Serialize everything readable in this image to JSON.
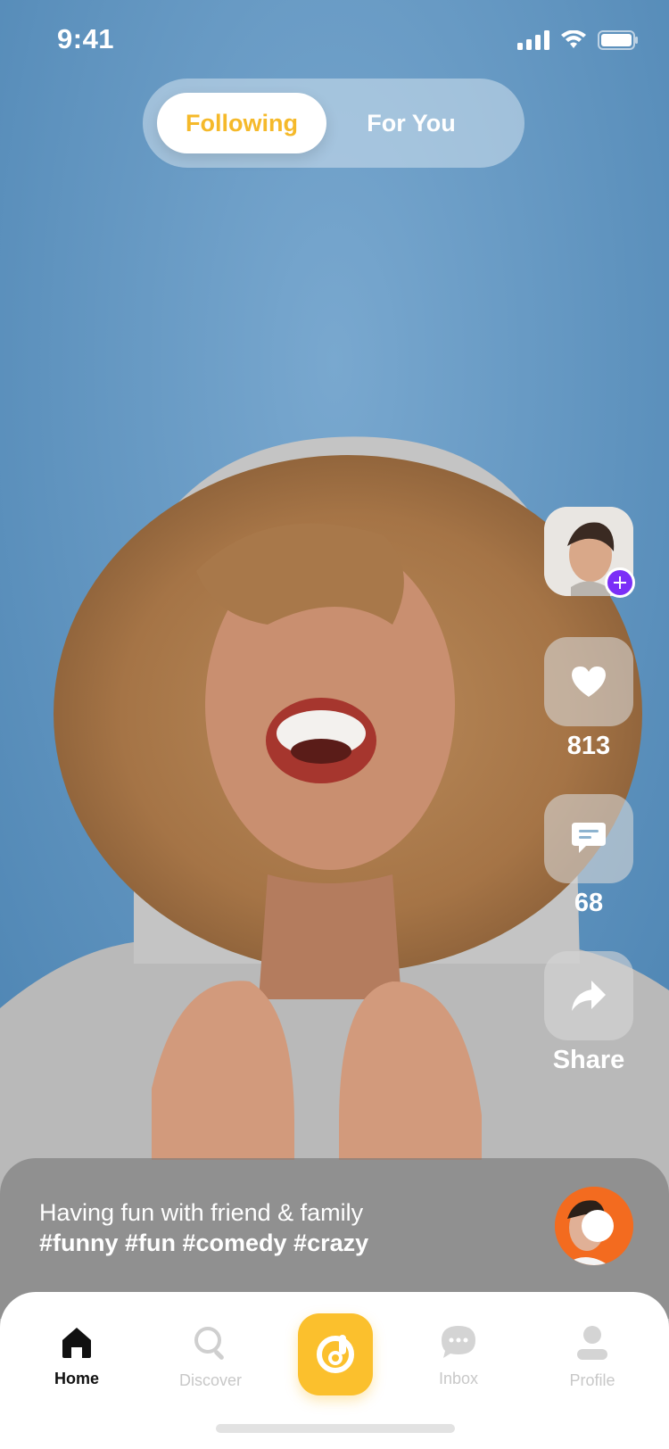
{
  "status_bar": {
    "time": "9:41",
    "icons": [
      "signal-icon",
      "wifi-icon",
      "battery-icon"
    ]
  },
  "feed_tabs": {
    "active": "Following",
    "items": [
      {
        "label": "Following",
        "active": true
      },
      {
        "label": "For You",
        "active": false
      }
    ]
  },
  "actions": {
    "creator_avatar": {
      "icon": "plus-icon"
    },
    "like": {
      "icon": "heart-icon",
      "count": "813"
    },
    "comment": {
      "icon": "comment-icon",
      "count": "68"
    },
    "share": {
      "icon": "share-icon",
      "label": "Share"
    }
  },
  "caption": {
    "text": "Having fun with friend & family",
    "hashtags": "#funny #fun #comedy #crazy"
  },
  "bottom_nav": {
    "items": [
      {
        "label": "Home",
        "icon": "home-icon",
        "active": true
      },
      {
        "label": "Discover",
        "icon": "search-icon",
        "active": false
      },
      {
        "label": "",
        "icon": "create-icon",
        "active": false
      },
      {
        "label": "Inbox",
        "icon": "inbox-icon",
        "active": false
      },
      {
        "label": "Profile",
        "icon": "profile-icon",
        "active": false
      }
    ]
  },
  "colors": {
    "accent": "#FBC02D",
    "active_tab_text": "#F5B92A",
    "follow_badge": "#7B2FF7",
    "music_disc": "#F36B1F",
    "background_blue": "#5F93BD"
  }
}
